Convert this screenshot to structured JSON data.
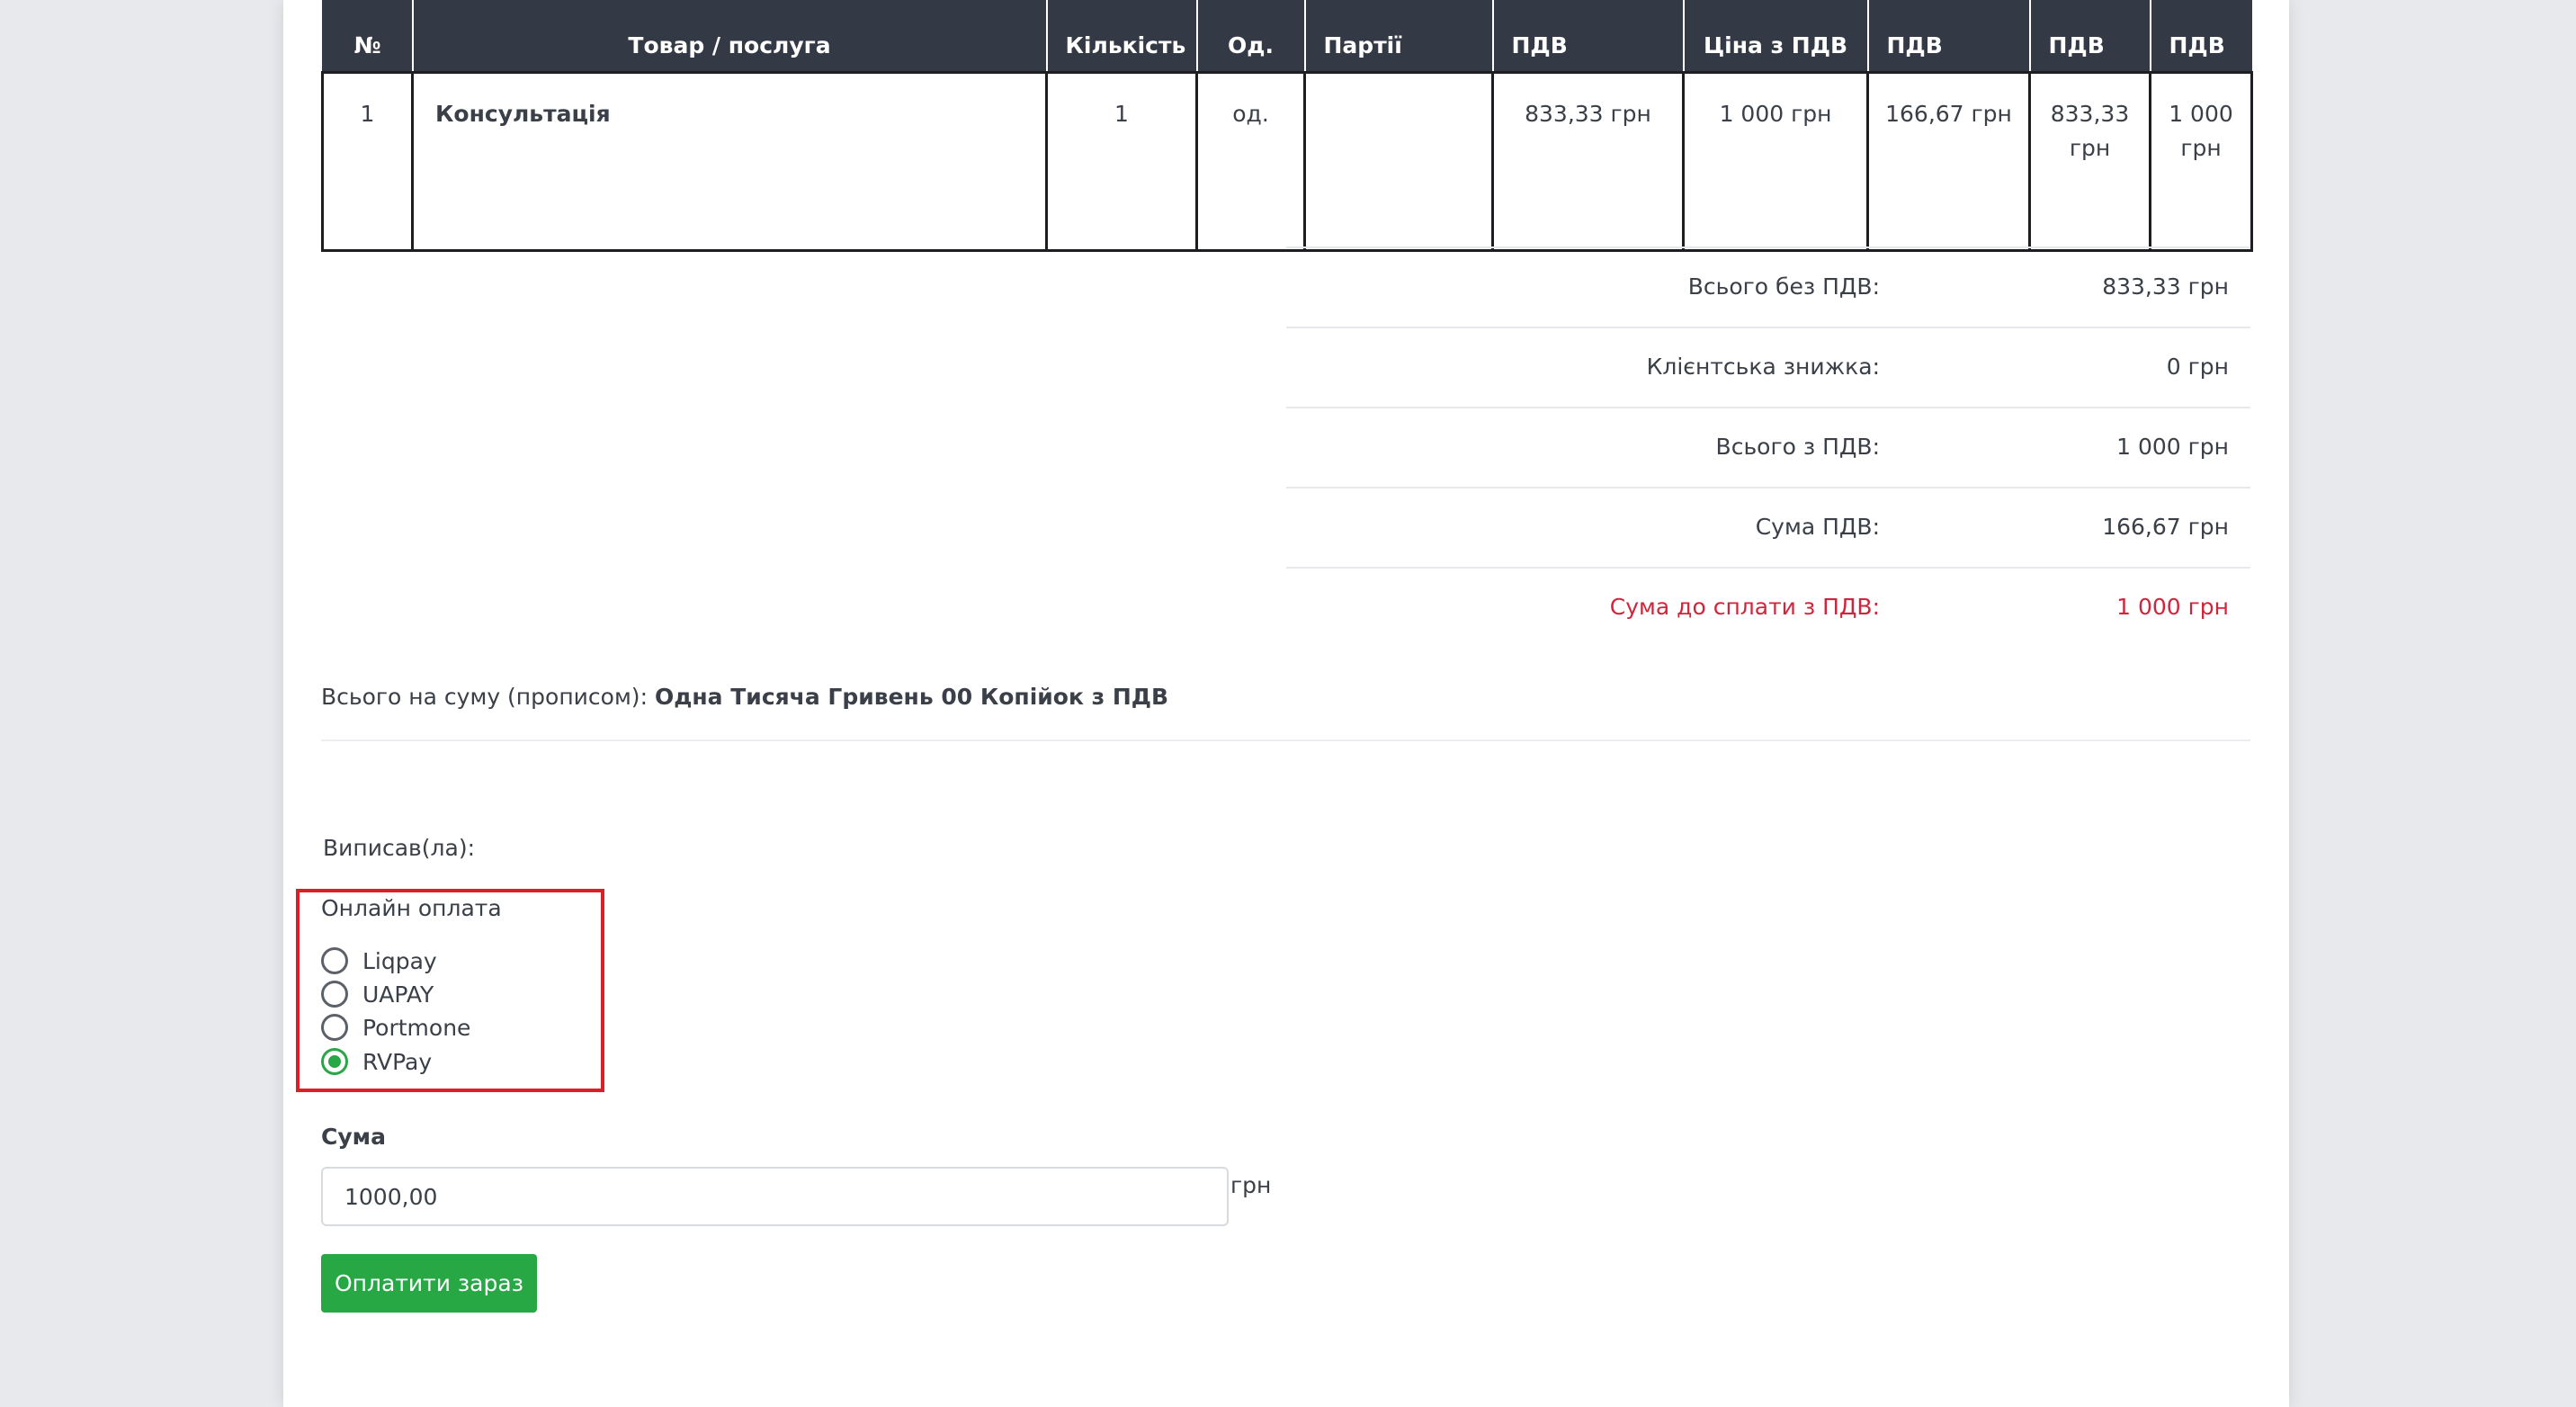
{
  "table": {
    "headers": [
      "№",
      "Товар / послуга",
      "Кількість",
      "Од.",
      "Партії",
      "ПДВ",
      "Ціна з ПДВ",
      "ПДВ",
      "ПДВ",
      "ПДВ"
    ],
    "row": {
      "num": "1",
      "name": "Консультація",
      "qty": "1",
      "unit": "од.",
      "batches": "",
      "vat_base": "833,33 грн",
      "price_vat": "1 000 грн",
      "vat_amount": "166,67 грн",
      "sum_no_vat": "833,33 грн",
      "sum_vat": "1 000 грн"
    }
  },
  "totals": [
    {
      "label": "Всього без ПДВ:",
      "value": "833,33 грн"
    },
    {
      "label": "Клієнтська знижка:",
      "value": "0 грн"
    },
    {
      "label": "Всього з ПДВ:",
      "value": "1 000 грн"
    },
    {
      "label": "Сума ПДВ:",
      "value": "166,67 грн"
    },
    {
      "label": "Сума до сплати з ПДВ:",
      "value": "1 000 грн"
    }
  ],
  "amount_words": {
    "label": "Всього на суму (прописом):",
    "value": "Одна Тисяча Гривень 00 Копійок з ПДВ"
  },
  "issued_by_label": "Виписав(ла):",
  "payment": {
    "title": "Онлайн оплата",
    "options": [
      "Liqpay",
      "UAPAY",
      "Portmone",
      "RVPay"
    ],
    "selected": "RVPay",
    "highlight_color": "#dc1f26",
    "amount_label": "Сума",
    "amount_value": "1000,00",
    "currency": "грн",
    "pay_button": "Оплатити зараз",
    "button_color": "#28a745"
  },
  "colors": {
    "header_bg": "#343a45",
    "total_due": "#d0253c"
  }
}
